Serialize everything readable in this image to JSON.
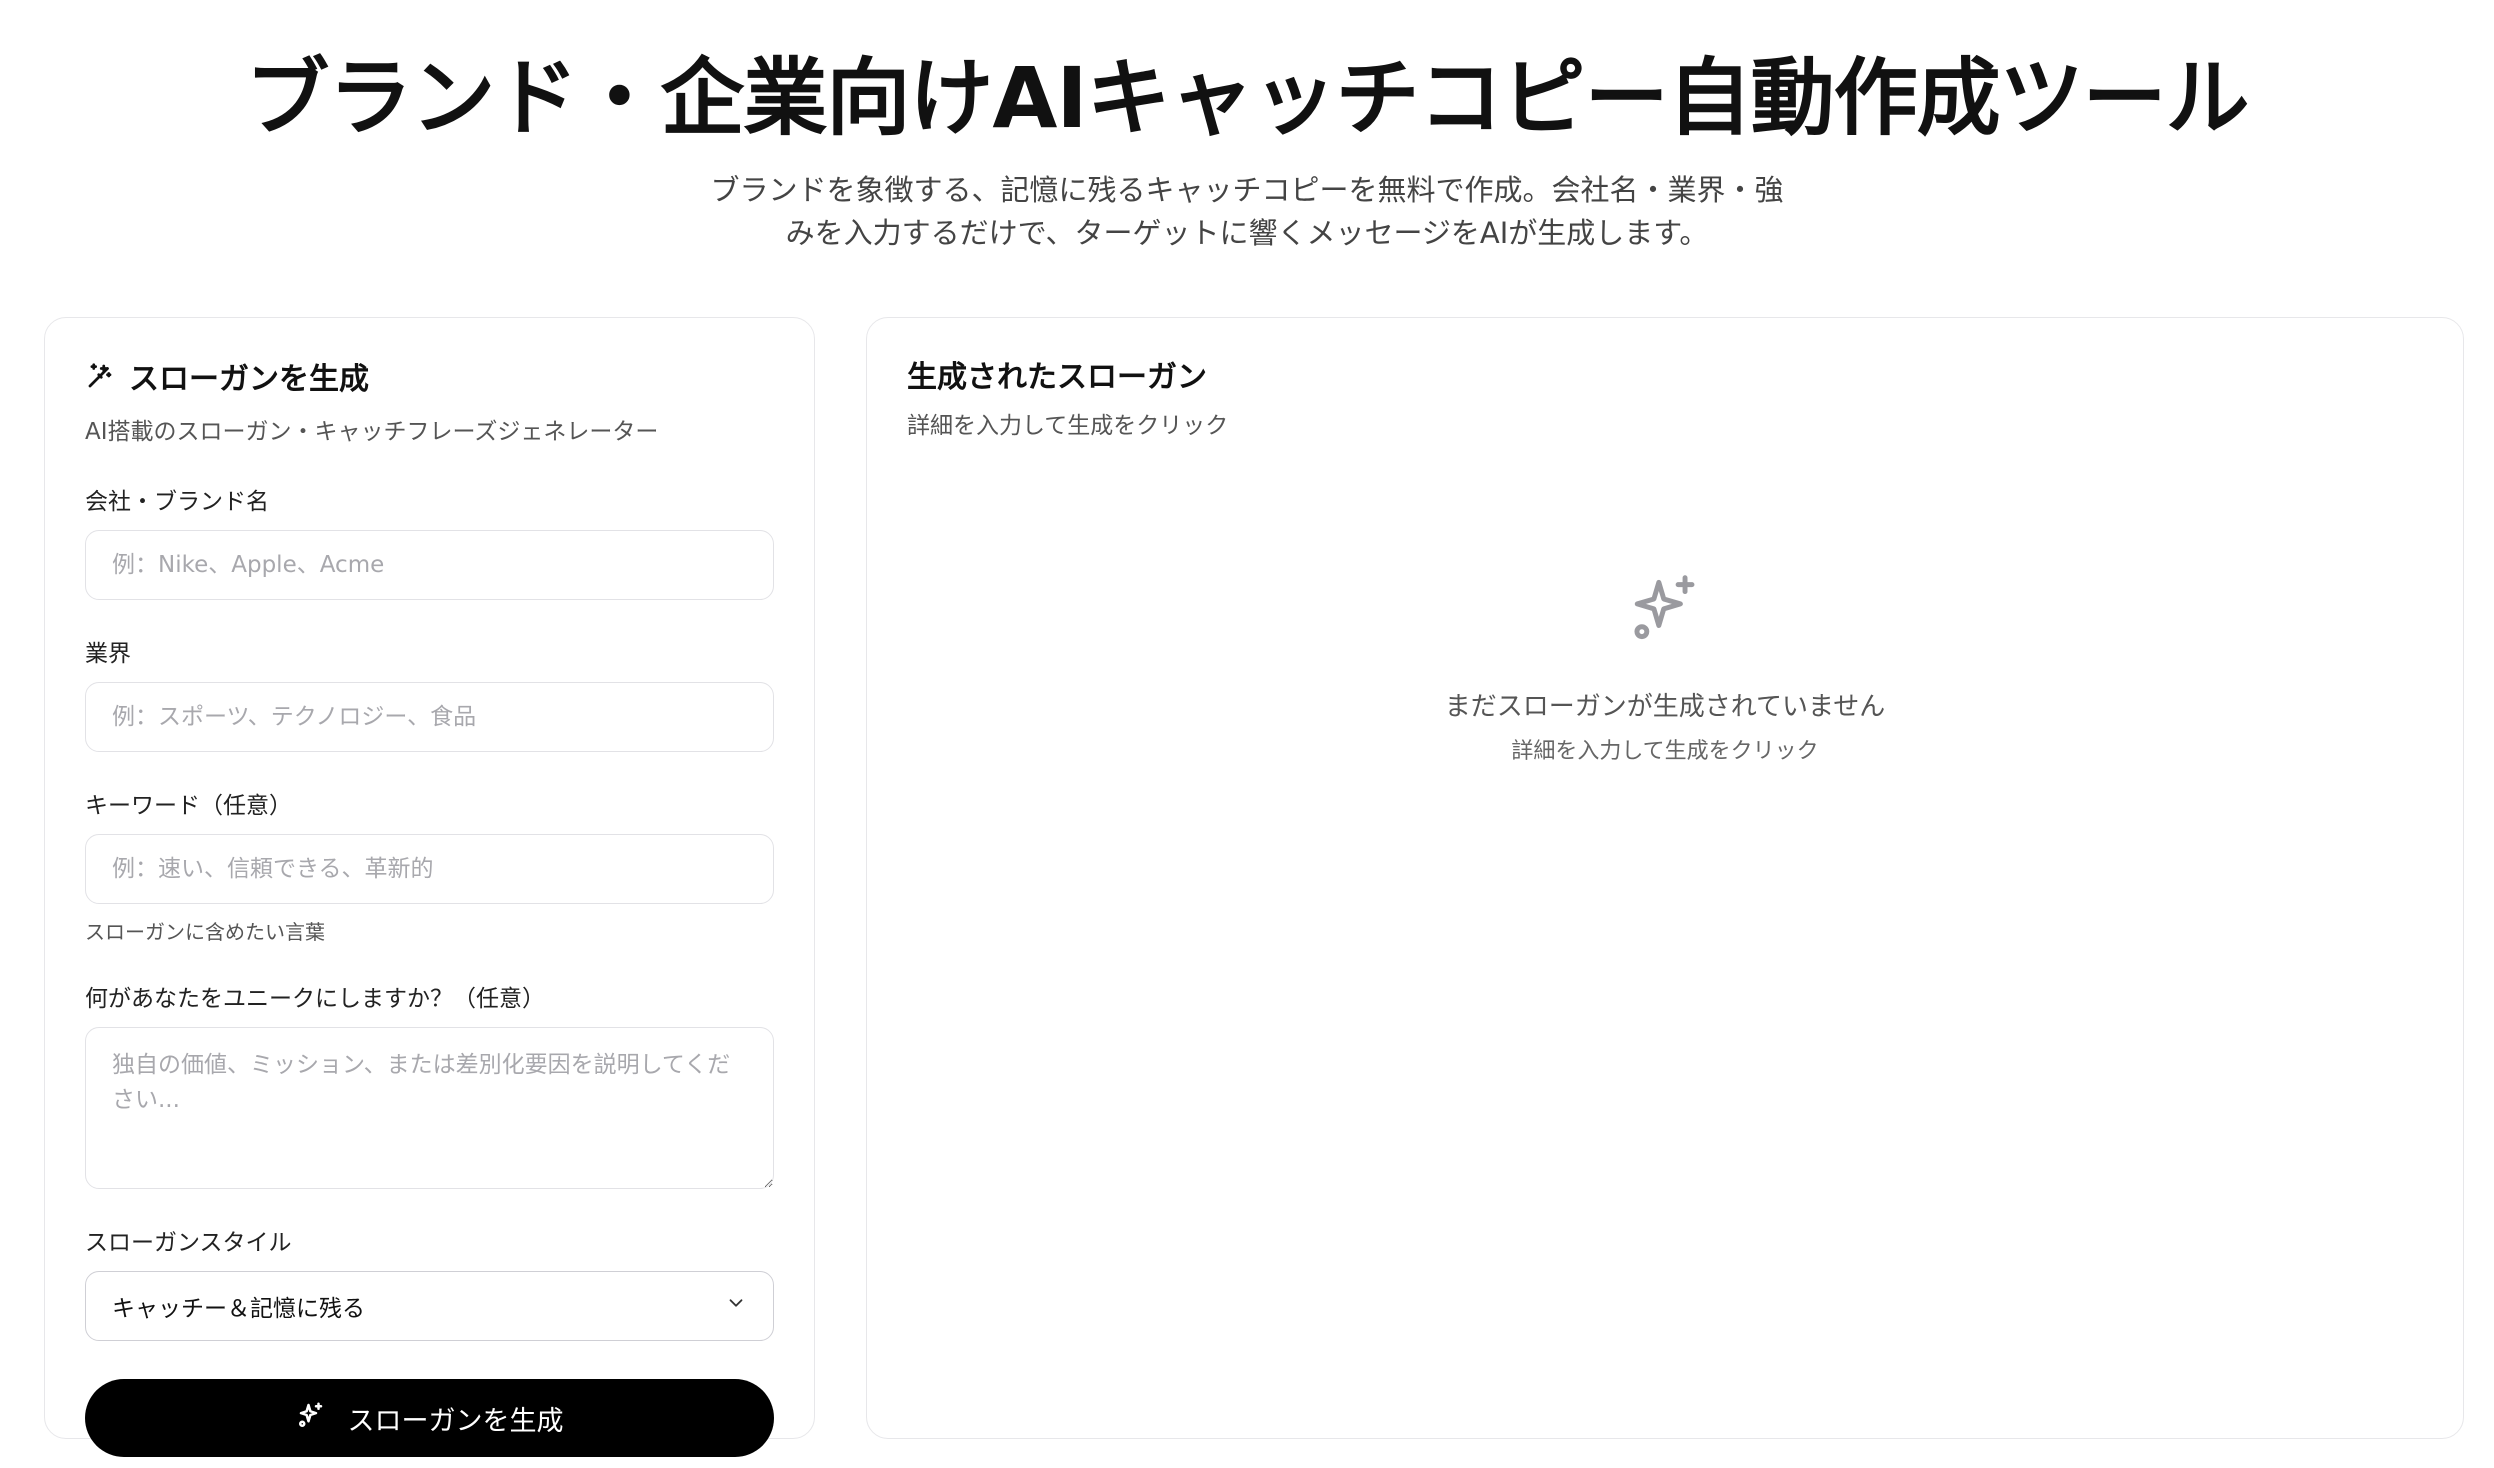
{
  "header": {
    "title": "ブランド・企業向けAIキャッチコピー自動作成ツール",
    "subtitle_line1": "ブランドを象徴する、記憶に残るキャッチコピーを無料で作成。会社名・業界・強",
    "subtitle_line2": "みを入力するだけで、ターゲットに響くメッセージをAIが生成します。"
  },
  "form": {
    "icon": "wand-sparkles-icon",
    "title": "スローガンを生成",
    "description": "AI搭載のスローガン・キャッチフレーズジェネレーター",
    "company": {
      "label": "会社・ブランド名",
      "placeholder": "例：Nike、Apple、Acme",
      "value": ""
    },
    "industry": {
      "label": "業界",
      "placeholder": "例：スポーツ、テクノロジー、食品",
      "value": ""
    },
    "keywords": {
      "label": "キーワード（任意）",
      "placeholder": "例：速い、信頼できる、革新的",
      "value": "",
      "helper": "スローガンに含めたい言葉"
    },
    "unique": {
      "label": "何があなたをユニークにしますか？（任意）",
      "placeholder": "独自の価値、ミッション、または差別化要因を説明してください...",
      "value": ""
    },
    "style": {
      "label": "スローガンスタイル",
      "selected": "キャッチー＆記憶に残る"
    },
    "submit_label": "スローガンを生成",
    "submit_icon": "sparkles-icon"
  },
  "results": {
    "title": "生成されたスローガン",
    "description": "詳細を入力して生成をクリック",
    "empty_icon": "sparkles-icon",
    "empty_title": "まだスローガンが生成されていません",
    "empty_sub": "詳細を入力して生成をクリック"
  },
  "colors": {
    "primary_button": "#000000",
    "border": "#e7e7ea",
    "muted_text": "#555555",
    "placeholder": "#a8a8ad"
  }
}
